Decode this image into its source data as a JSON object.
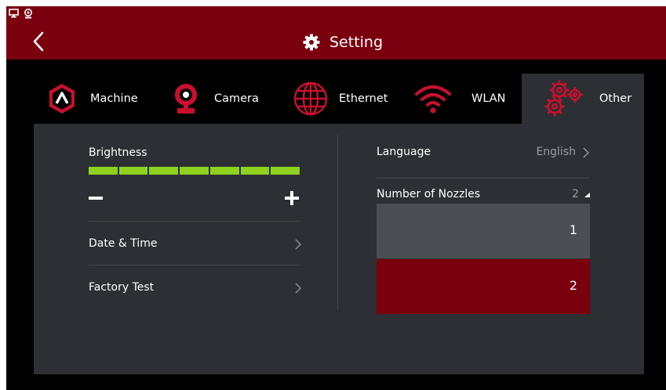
{
  "header": {
    "title": "Setting",
    "title_icon": "gear-icon",
    "back_icon": "back-arrow-icon",
    "status_icons": [
      "monitor-icon",
      "webcam-icon"
    ]
  },
  "tabs": [
    {
      "label": "Machine",
      "icon": "machine-logo-icon",
      "active": false
    },
    {
      "label": "Camera",
      "icon": "camera-icon",
      "active": false
    },
    {
      "label": "Ethernet",
      "icon": "globe-icon",
      "active": false
    },
    {
      "label": "WLAN",
      "icon": "wifi-icon",
      "active": false
    },
    {
      "label": "Other",
      "icon": "gears-icon",
      "active": true
    }
  ],
  "left": {
    "brightness": {
      "label": "Brightness",
      "segments_total": 7,
      "segments_filled": 7,
      "level": 1.0,
      "decrease_icon": "minus-icon",
      "increase_icon": "plus-icon"
    },
    "rows": [
      {
        "label": "Date & Time",
        "icon": "chevron-right-icon"
      },
      {
        "label": "Factory Test",
        "icon": "chevron-right-icon"
      }
    ]
  },
  "right": {
    "language": {
      "label": "Language",
      "value": "English"
    },
    "nozzles": {
      "label": "Number of Nozzles",
      "value": "2",
      "expanded": true,
      "options": [
        "1",
        "2"
      ],
      "selected": "2"
    }
  },
  "colors": {
    "accent": "#7b000e",
    "panel": "#2c2f33",
    "brightness_fill": "#8ed21f",
    "option_bg": "#4b4f54",
    "muted_text": "#9a9da2"
  }
}
